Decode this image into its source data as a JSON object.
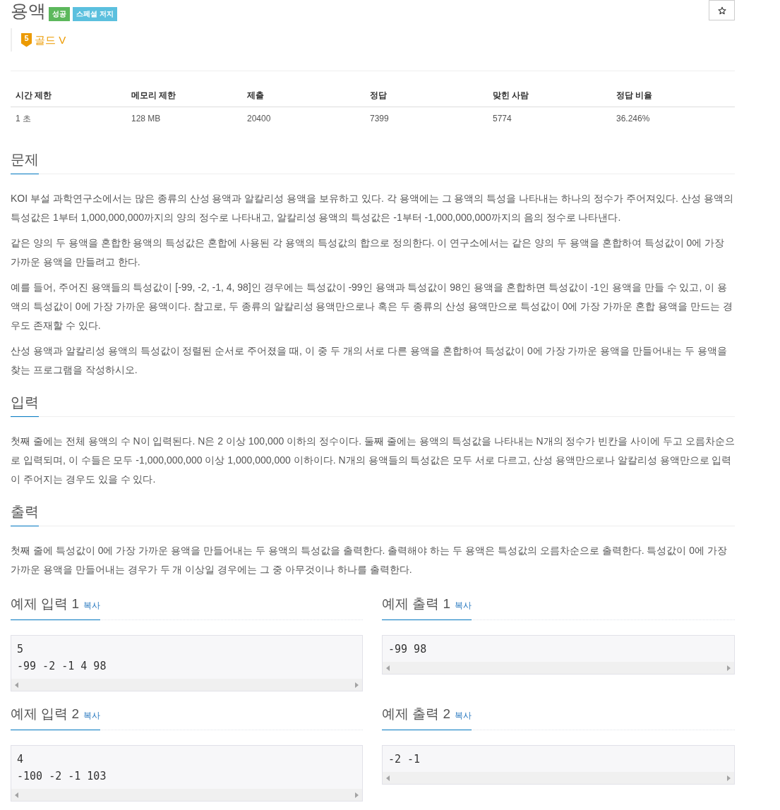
{
  "problem": {
    "title": "용액",
    "badges": [
      {
        "label": "성공",
        "kind": "success"
      },
      {
        "label": "스페셜 저지",
        "kind": "info"
      }
    ],
    "tier": {
      "rank": "5",
      "label": "골드 V"
    }
  },
  "info_table": {
    "columns": [
      "시간 제한",
      "메모리 제한",
      "제출",
      "정답",
      "맞힌 사람",
      "정답 비율"
    ],
    "rows": [
      [
        "1 초",
        "128 MB",
        "20400",
        "7399",
        "5774",
        "36.246%"
      ]
    ]
  },
  "sections": [
    {
      "heading": "문제",
      "paragraphs": [
        "KOI 부설 과학연구소에서는 많은 종류의 산성 용액과 알칼리성 용액을 보유하고 있다. 각 용액에는 그 용액의 특성을 나타내는 하나의 정수가 주어져있다. 산성 용액의 특성값은 1부터 1,000,000,000까지의 양의 정수로 나타내고, 알칼리성 용액의 특성값은 -1부터 -1,000,000,000까지의 음의 정수로 나타낸다.",
        "같은 양의 두 용액을 혼합한 용액의 특성값은 혼합에 사용된 각 용액의 특성값의 합으로 정의한다. 이 연구소에서는 같은 양의 두 용액을 혼합하여 특성값이 0에 가장 가까운 용액을 만들려고 한다.",
        "예를 들어, 주어진 용액들의 특성값이 [-99, -2, -1, 4, 98]인 경우에는 특성값이 -99인 용액과 특성값이 98인 용액을 혼합하면 특성값이 -1인 용액을 만들 수 있고, 이 용액의 특성값이 0에 가장 가까운 용액이다. 참고로, 두 종류의 알칼리성 용액만으로나 혹은 두 종류의 산성 용액만으로 특성값이 0에 가장 가까운 혼합 용액을 만드는 경우도 존재할 수 있다.",
        "산성 용액과 알칼리성 용액의 특성값이 정렬된 순서로 주어졌을 때, 이 중 두 개의 서로 다른 용액을 혼합하여 특성값이 0에 가장 가까운 용액을 만들어내는 두 용액을 찾는 프로그램을 작성하시오."
      ]
    },
    {
      "heading": "입력",
      "paragraphs": [
        "첫째 줄에는 전체 용액의 수 N이 입력된다. N은 2 이상 100,000 이하의 정수이다. 둘째 줄에는 용액의 특성값을 나타내는 N개의 정수가 빈칸을 사이에 두고 오름차순으로 입력되며, 이 수들은 모두 -1,000,000,000 이상 1,000,000,000 이하이다. N개의 용액들의 특성값은 모두 서로 다르고, 산성 용액만으로나 알칼리성 용액만으로 입력이 주어지는 경우도 있을 수 있다."
      ]
    },
    {
      "heading": "출력",
      "paragraphs": [
        "첫째 줄에 특성값이 0에 가장 가까운 용액을 만들어내는 두 용액의 특성값을 출력한다. 출력해야 하는 두 용액은 특성값의 오름차순으로 출력한다. 특성값이 0에 가장 가까운 용액을 만들어내는 경우가 두 개 이상일 경우에는 그 중 아무것이나 하나를 출력한다."
      ]
    }
  ],
  "samples": [
    {
      "heading": "예제 입력 1",
      "copy_link": "복사",
      "content": "5\n-99 -2 -1 4 98"
    },
    {
      "heading": "예제 출력 1",
      "copy_link": "복사",
      "content": "-99 98"
    },
    {
      "heading": "예제 입력 2",
      "copy_link": "복사",
      "content": "4\n-100 -2 -1 103"
    },
    {
      "heading": "예제 출력 2",
      "copy_link": "복사",
      "content": "-2 -1"
    }
  ]
}
